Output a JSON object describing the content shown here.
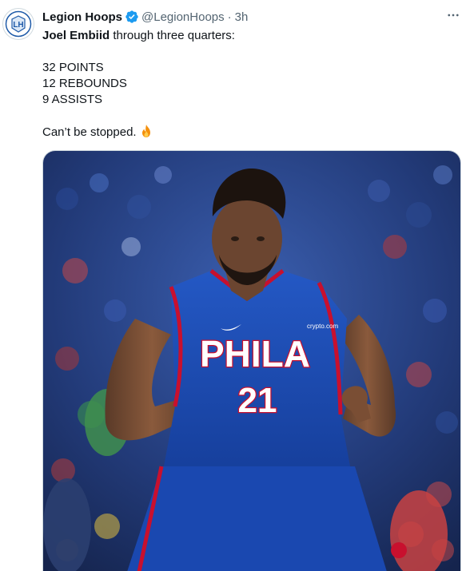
{
  "tweet": {
    "author_name": "Legion Hoops",
    "handle": "@LegionHoops",
    "separator": "·",
    "time": "3h",
    "text": {
      "player_name": "Joel Embiid",
      "intro_rest": " through three quarters:",
      "stat_points": "32 POINTS",
      "stat_rebounds": "12 REBOUNDS",
      "stat_assists": "9 ASSISTS",
      "closing": "Can’t be stopped."
    },
    "avatar_logo_text": "LH",
    "image": {
      "jersey_text": "PHILA",
      "jersey_number": "21",
      "sponsor_text": "crypto.com"
    }
  },
  "colors": {
    "verified_blue": "#1d9bf0",
    "secondary_text": "#536471",
    "jersey_blue": "#1d4fb8",
    "jersey_red": "#c8102e"
  },
  "icons": {
    "verified": "verified-badge-icon",
    "more": "more-options-icon",
    "fire": "fire-emoji-icon",
    "avatar": "legion-hoops-logo-icon"
  }
}
